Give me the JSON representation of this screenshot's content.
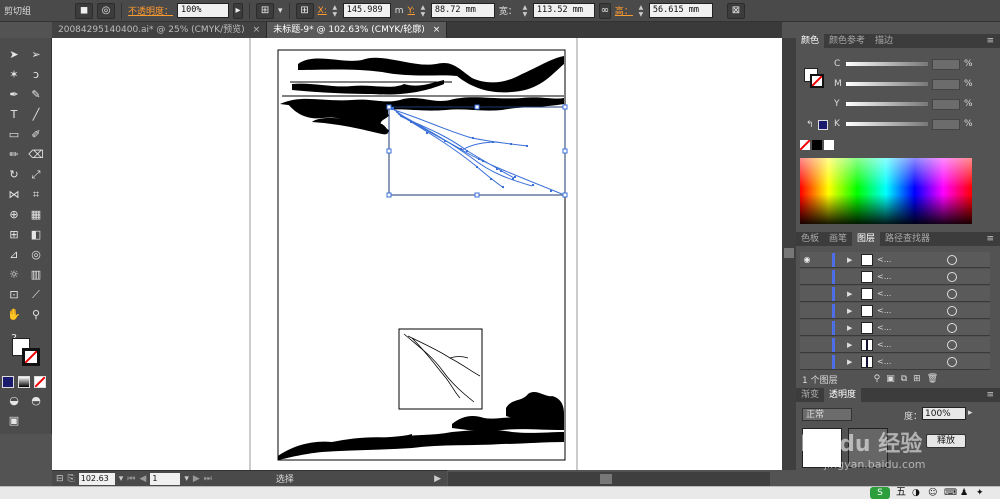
{
  "control_bar": {
    "tool_name": "剪切组",
    "opacity_label": "不透明度：",
    "opacity_value": "100%",
    "x_label": "X:",
    "x_value": "145.989",
    "x_unit": "m",
    "y_label": "Y:",
    "y_value": "88.72 mm",
    "width_label": "宽：",
    "width_value": "113.52 mm",
    "height_label": "高：",
    "height_value": "56.615 mm"
  },
  "doc_tabs": [
    {
      "label": "20084295140400.ai* @ 25% (CMYK/预览)",
      "close": "×"
    },
    {
      "label": "未标题-9* @ 102.63% (CMYK/轮廓)",
      "close": "×"
    }
  ],
  "status_bar": {
    "zoom": "102.63",
    "page": "1",
    "mode": "选择"
  },
  "color_panel": {
    "tabs": [
      "颜色",
      "颜色参考",
      "描边"
    ],
    "channels": [
      {
        "label": "C",
        "unit": "%"
      },
      {
        "label": "M",
        "unit": "%"
      },
      {
        "label": "Y",
        "unit": "%"
      },
      {
        "label": "K",
        "unit": "%"
      }
    ]
  },
  "layers_panel": {
    "tabs": [
      "色板",
      "画笔",
      "图层",
      "路径查找器"
    ],
    "rows": [
      {
        "name": "<...",
        "visible": true,
        "expand": "▶"
      },
      {
        "name": "<...",
        "visible": false,
        "expand": ""
      },
      {
        "name": "<...",
        "visible": false,
        "expand": "▶"
      },
      {
        "name": "<...",
        "visible": false,
        "expand": "▶"
      },
      {
        "name": "<...",
        "visible": false,
        "expand": "▶"
      },
      {
        "name": "<...",
        "visible": false,
        "expand": "▶"
      },
      {
        "name": "<...",
        "visible": false,
        "expand": "▶"
      }
    ],
    "layer_count": "1 个图层"
  },
  "transparency_panel": {
    "tabs": [
      "渐变",
      "透明度"
    ],
    "blend_mode": "正常",
    "opacity_label": "度：",
    "opacity_value": "100%",
    "release_button": "释放"
  },
  "watermark": {
    "text": "Baidu 经验",
    "url": "jingyan.baidu.com"
  },
  "taskbar": {
    "ime": "五"
  }
}
